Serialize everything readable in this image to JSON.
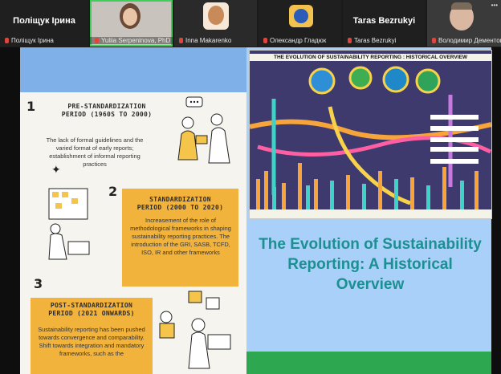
{
  "participants": [
    {
      "name": "Поліщук Ірина",
      "display": "Поліщук Ірина",
      "video": false
    },
    {
      "name": "Yuliia Serpeninova, PhD",
      "video": true,
      "active": true
    },
    {
      "name": "Inna Makarenko",
      "video": true
    },
    {
      "name": "Олександр Гладюк",
      "video": true
    },
    {
      "name": "Taras Bezrukyi",
      "display": "Taras Bezrukyi",
      "video": false
    },
    {
      "name": "Володимир Дементов",
      "video": true
    }
  ],
  "strip": {
    "more_label": "•••"
  },
  "slide": {
    "left": {
      "step1": {
        "number": "1",
        "title": "PRE-STANDARDIZATION\nPERIOD (1960S TO 2000)",
        "body": "The lack of formal guidelines and the varied format of early reports; establishment of informal reporting practices"
      },
      "step2": {
        "number": "2",
        "title": "STANDARDIZATION\nPERIOD (2000 TO 2020)",
        "body": "Increasement of the role of methodological frameworks in shaping sustainability reporting practices. The introduction of the GRI, SASB, TCFD, ISO, IR and other frameworks"
      },
      "step3": {
        "number": "3",
        "title": "POST-STANDARDIZATION\nPERIOD (2021 ONWARDS)",
        "body": "Sustainability reporting has been pushed towards convergence and comparability. Shift towards integration and mandatory frameworks, such as the"
      }
    },
    "right": {
      "infographic_title": "THE EVOLUTION OF SUSTAINABILITY REPORTING : HISTORICAL OVERVIEW",
      "title": "The Evolution of Sustainability Reporting: A Historical Overview"
    }
  },
  "colors": {
    "accent": "#f2b33c",
    "title": "#1b8f92",
    "active_speaker": "#3fce5a"
  }
}
